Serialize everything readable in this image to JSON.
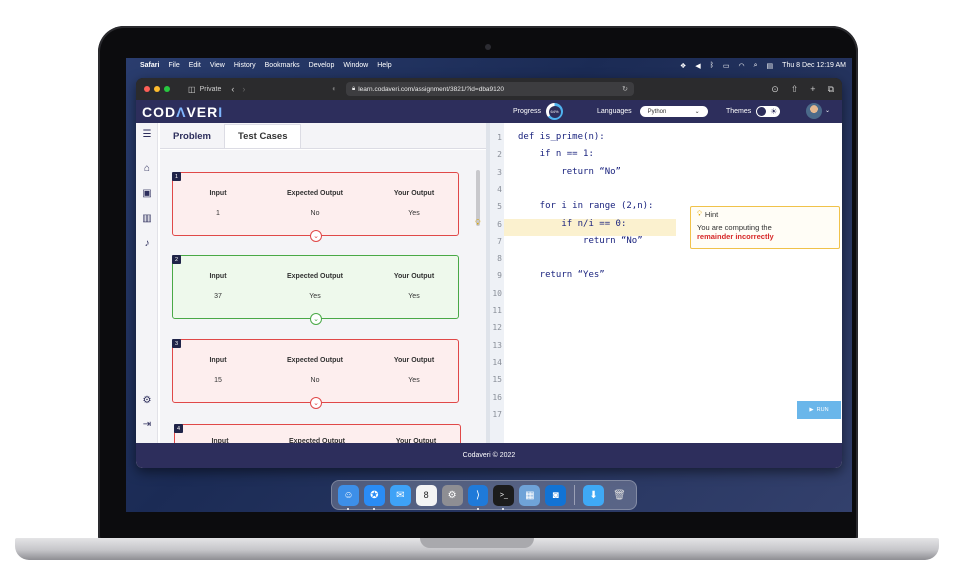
{
  "menubar": {
    "app": "Safari",
    "items": [
      "File",
      "Edit",
      "View",
      "History",
      "Bookmarks",
      "Develop",
      "Window",
      "Help"
    ],
    "clock": "Thu 8 Dec  12:19 AM"
  },
  "browser": {
    "private_label": "Private",
    "url": "learn.codaveri.com/assignment/3821/?id=dba9120"
  },
  "app": {
    "logo_left": "COD",
    "logo_accent": "Λ",
    "logo_mid": "VER",
    "logo_end": "I",
    "progress_label": "Progress",
    "progress_value": "64%",
    "progress_fraction": 0.64,
    "languages_label": "Languages",
    "language_selected": "Python",
    "themes_label": "Themes",
    "footer": "Codaveri © 2022"
  },
  "tabs": [
    {
      "label": "Problem",
      "active": false
    },
    {
      "label": "Test Cases",
      "active": true
    }
  ],
  "test_headers": {
    "input": "Input",
    "expected": "Expected Output",
    "yours": "Your Output"
  },
  "test_cases": [
    {
      "num": "1",
      "input": "1",
      "expected": "No",
      "yours": "Yes",
      "status": "fail"
    },
    {
      "num": "2",
      "input": "37",
      "expected": "Yes",
      "yours": "Yes",
      "status": "pass"
    },
    {
      "num": "3",
      "input": "15",
      "expected": "No",
      "yours": "Yes",
      "status": "fail"
    },
    {
      "num": "4",
      "input": "",
      "expected": "",
      "yours": "",
      "status": "fail"
    }
  ],
  "code_lines": [
    "def is_prime(n):",
    "    if n == 1:",
    "        return “No”",
    "",
    "    for i in range (2,n):",
    "        if n/i == 0:",
    "            return “No”",
    "",
    "    return “Yes”",
    "",
    "",
    "",
    "",
    "",
    "",
    "",
    ""
  ],
  "line_numbers": [
    "1",
    "2",
    "3",
    "4",
    "5",
    "6",
    "7",
    "8",
    "9",
    "10",
    "11",
    "12",
    "13",
    "14",
    "15",
    "16",
    "17"
  ],
  "hint": {
    "title": "Hint",
    "line1": "You are computing the",
    "line2": "remainder incorrectly"
  },
  "run_label": "RUN",
  "colors": {
    "brand": "#2d2e5c",
    "fail": "#e04848",
    "pass": "#49a946",
    "run": "#6ab6ea",
    "progress": "#4fb3f0"
  }
}
